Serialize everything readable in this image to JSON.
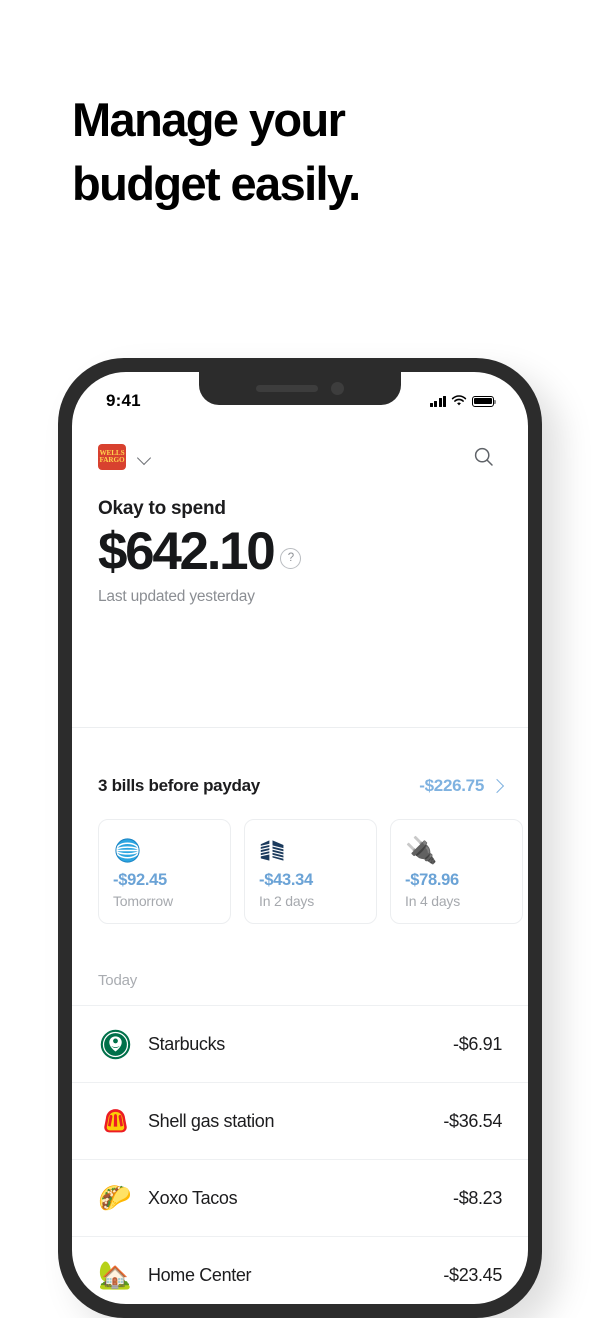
{
  "headline": {
    "line1": "Manage your",
    "line2": "budget easily."
  },
  "phone": {
    "status_bar": {
      "time": "9:41",
      "signal_icon": "cellular-signal-icon",
      "wifi_icon": "wifi-icon",
      "battery_icon": "battery-full-icon"
    },
    "app_header": {
      "bank_logo_line1": "WELLS",
      "bank_logo_line2": "FARGO",
      "account_chevron_icon": "chevron-down-icon",
      "search_icon": "search-icon"
    },
    "balance": {
      "label": "Okay to spend",
      "amount": "$642.10",
      "help_icon": "?",
      "subtext": "Last updated yesterday"
    },
    "bills": {
      "title": "3 bills before payday",
      "total": "-$226.75",
      "chevron_icon": "chevron-right-icon",
      "cards": [
        {
          "icon": "att-globe-logo",
          "amount": "-$92.45",
          "when": "Tomorrow"
        },
        {
          "icon": "navy-striped-logo",
          "amount": "-$43.34",
          "when": "In 2 days"
        },
        {
          "icon": "🔌",
          "amount": "-$78.96",
          "when": "In 4 days"
        }
      ]
    },
    "transactions": {
      "day_label": "Today",
      "items": [
        {
          "icon": "starbucks-logo",
          "name": "Starbucks",
          "amount": "-$6.91"
        },
        {
          "icon": "🐚",
          "name": "Shell gas station",
          "amount": "-$36.54"
        },
        {
          "icon": "🌮",
          "name": "Xoxo Tacos",
          "amount": "-$8.23"
        },
        {
          "icon": "🏡",
          "name": "Home Center",
          "amount": "-$23.45"
        }
      ]
    }
  },
  "colors": {
    "accent_blue": "#6ba3d6",
    "bills_total_blue": "#7fb2e0",
    "brand_red": "#d8412f",
    "brand_yellow": "#ffd24d",
    "phone_frame": "#2c2c2c",
    "text_primary": "#1c1c1e",
    "text_muted": "#8b8e93"
  }
}
